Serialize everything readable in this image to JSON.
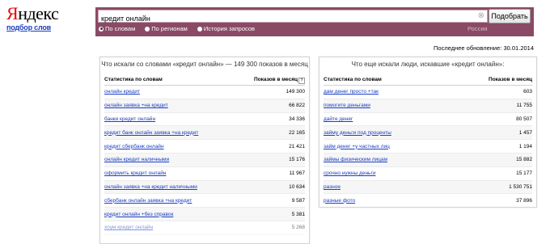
{
  "logo": {
    "mark_first": "Я",
    "mark_rest": "ндекс",
    "subtitle": "подбор слов"
  },
  "search": {
    "query": "кредит онлайн",
    "clear_glyph": "⊗",
    "button_label": "Подобрать",
    "modes": [
      {
        "label": "По словам",
        "selected": true
      },
      {
        "label": "По регионам",
        "selected": false
      },
      {
        "label": "История запросов",
        "selected": false
      }
    ],
    "region": "Россия"
  },
  "updated": "Последнее обновление: 30.01.2014",
  "left_panel": {
    "title": "Что искали со словами «кредит онлайн» — 149 300 показов в месяц",
    "col_phrase": "Статистика по словам",
    "col_count": "Показов в месяц",
    "rows": [
      {
        "phrase": "онлайн кредит",
        "count": "149 300"
      },
      {
        "phrase": "онлайн заявка +на кредит",
        "count": "66 822"
      },
      {
        "phrase": "банки кредит онлайн",
        "count": "34 336"
      },
      {
        "phrase": "кредит банк онлайн заявка +на кредит",
        "count": "22 165"
      },
      {
        "phrase": "кредит сбербанк онлайн",
        "count": "21 421"
      },
      {
        "phrase": "онлайн кредит наличными",
        "count": "15 176"
      },
      {
        "phrase": "оформить кредит онлайн",
        "count": "11 967"
      },
      {
        "phrase": "онлайн заявка +на кредит наличными",
        "count": "10 634"
      },
      {
        "phrase": "сбербанк онлайн заявка +на кредит",
        "count": "9 587"
      },
      {
        "phrase": "кредит онлайн +без справок",
        "count": "5 381"
      },
      {
        "phrase": "хоум кредит онлайн",
        "count": "5 268"
      }
    ]
  },
  "right_panel": {
    "title": "Что еще искали люди, искавшие «кредит онлайн»:",
    "col_phrase": "Статистика по словам",
    "col_count": "Показов в месяц",
    "rows": [
      {
        "phrase": "дам денег просто +так",
        "count": "603"
      },
      {
        "phrase": "помогите деньгами",
        "count": "11 755"
      },
      {
        "phrase": "дайте денег",
        "count": "80 507"
      },
      {
        "phrase": "займу деньги под проценты",
        "count": "1 457"
      },
      {
        "phrase": "займ денег +у частных лиц",
        "count": "1 194"
      },
      {
        "phrase": "займы физическим лицам",
        "count": "15 882"
      },
      {
        "phrase": "срочно нужны деньги",
        "count": "15 177"
      },
      {
        "phrase": "разное",
        "count": "1 530 751"
      },
      {
        "phrase": "разные фото",
        "count": "37 896"
      }
    ]
  }
}
